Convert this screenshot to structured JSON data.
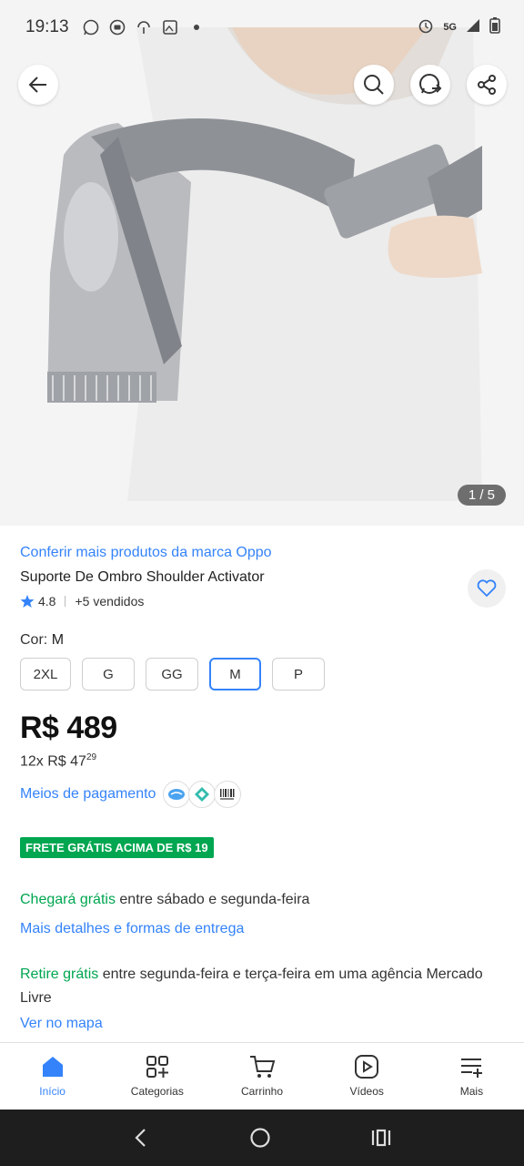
{
  "status_bar": {
    "time": "19:13",
    "network": "5G",
    "icons": [
      "whatsapp-icon",
      "chat-icon",
      "hotspot-icon",
      "photo-icon",
      "dot-icon"
    ],
    "right_icons": [
      "alarm-icon",
      "signal-icon",
      "battery-icon"
    ]
  },
  "hero": {
    "counter": "1 / 5",
    "buttons": [
      "back-icon",
      "search-icon",
      "whatsapp-share-icon",
      "share-icon"
    ]
  },
  "product": {
    "brand_link": "Conferir mais produtos da marca Oppo",
    "title": "Suporte De Ombro Shoulder Activator",
    "rating": "4.8",
    "sold": "+5 vendidos",
    "color_label": "Cor:",
    "color_value": "M",
    "sizes": [
      "2XL",
      "G",
      "GG",
      "M",
      "P"
    ],
    "selected_size": "M",
    "price": "R$ 489",
    "installments_prefix": "12x R$ 47",
    "installments_cents": "29",
    "payment_link": "Meios de pagamento",
    "payment_icons": [
      "mercadopago-icon",
      "pix-icon",
      "boleto-icon"
    ]
  },
  "shipping": {
    "badge": "FRETE GRÁTIS ACIMA DE R$ 19",
    "arrival_green": "Chegará grátis",
    "arrival_rest": " entre sábado e segunda-feira",
    "details_link": "Mais detalhes e formas de entrega",
    "pickup_green": "Retire grátis",
    "pickup_rest": " entre segunda-feira e terça-feira em uma agência Mercado Livre",
    "map_link": "Ver no mapa"
  },
  "bottom_nav": {
    "items": [
      "Início",
      "Categorias",
      "Carrinho",
      "Vídeos",
      "Mais"
    ],
    "active": "Início"
  },
  "colors": {
    "accent": "#3483fa",
    "green": "#00a650"
  }
}
